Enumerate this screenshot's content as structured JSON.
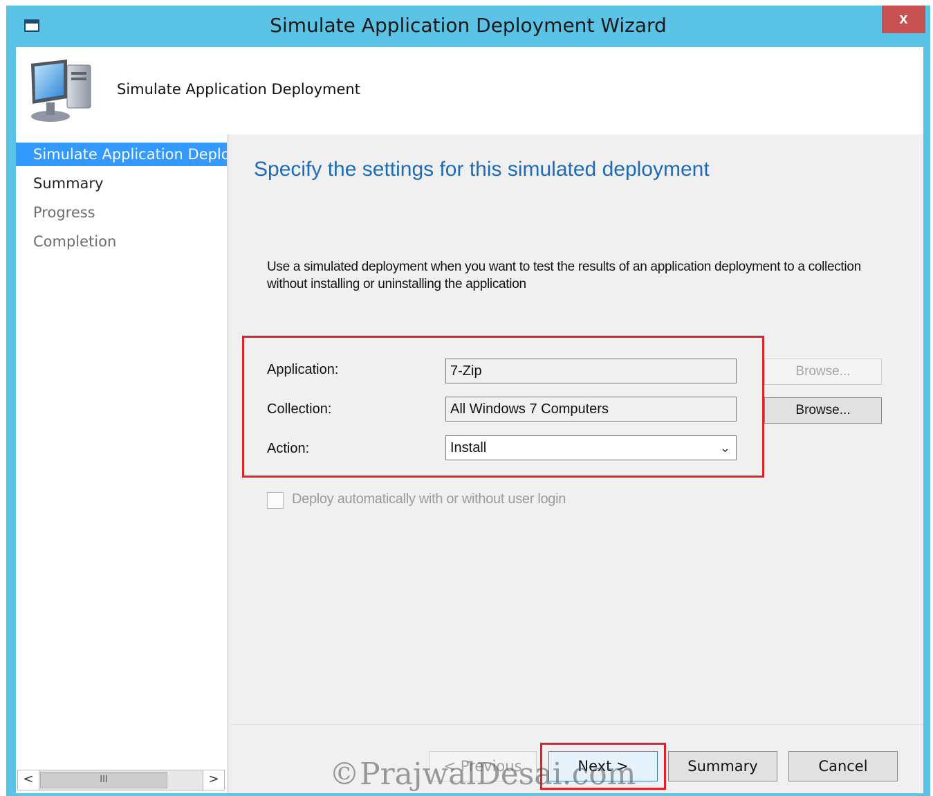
{
  "window": {
    "title": "Simulate Application Deployment Wizard",
    "close_label": "x"
  },
  "banner": {
    "title": "Simulate Application Deployment",
    "icon": "computer-icon"
  },
  "nav": {
    "items": [
      {
        "label": "Simulate Application Deployment",
        "state": "active"
      },
      {
        "label": "Summary",
        "state": "normal"
      },
      {
        "label": "Progress",
        "state": "disabled"
      },
      {
        "label": "Completion",
        "state": "disabled"
      }
    ],
    "scroll": {
      "left": "<",
      "thumb": "III",
      "right": ">"
    }
  },
  "page": {
    "heading": "Specify the settings for this simulated deployment",
    "description": "Use a simulated deployment when you want to test the results of an application deployment to a collection without installing or uninstalling the application"
  },
  "form": {
    "application": {
      "label": "Application:",
      "value": "7-Zip",
      "browse_label": "Browse..."
    },
    "collection": {
      "label": "Collection:",
      "value": "All Windows 7 Computers",
      "browse_label": "Browse..."
    },
    "action": {
      "label": "Action:",
      "value": "Install"
    },
    "deploy_automatically": {
      "label": "Deploy automatically with or without user login",
      "checked": false
    }
  },
  "footer": {
    "previous_label": "< Previous",
    "next_label": "Next >",
    "summary_label": "Summary",
    "cancel_label": "Cancel"
  },
  "watermark": "©PrajwalDesai.com",
  "colors": {
    "titlebar": "#5bc3e6",
    "heading": "#1e6bb8",
    "highlight": "#e0202a",
    "nav_active": "#3399ff"
  }
}
